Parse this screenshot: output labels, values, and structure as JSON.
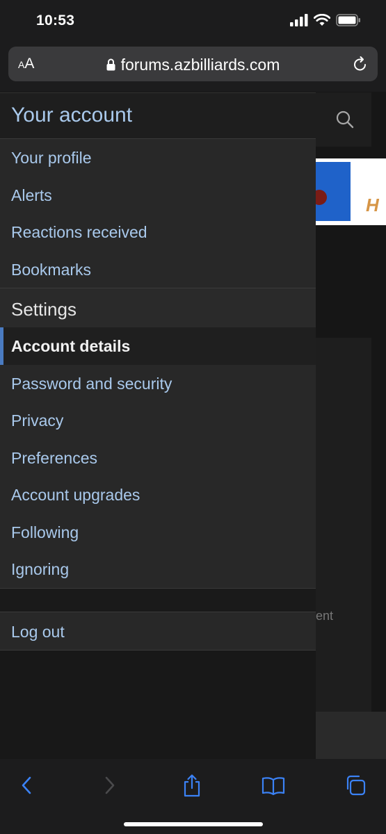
{
  "status": {
    "time": "10:53"
  },
  "browser": {
    "aa_label_small": "A",
    "aa_label_large": "A",
    "url": "forums.azbilliards.com"
  },
  "page": {
    "banner_text": "H",
    "partial_text": "ent"
  },
  "menu": {
    "title": "Your account",
    "account_items": [
      {
        "label": "Your profile"
      },
      {
        "label": "Alerts"
      },
      {
        "label": "Reactions received"
      },
      {
        "label": "Bookmarks"
      }
    ],
    "settings_title": "Settings",
    "settings_items": [
      {
        "label": "Account details",
        "active": true
      },
      {
        "label": "Password and security"
      },
      {
        "label": "Privacy"
      },
      {
        "label": "Preferences"
      },
      {
        "label": "Account upgrades"
      },
      {
        "label": "Following"
      },
      {
        "label": "Ignoring"
      }
    ],
    "logout_label": "Log out"
  },
  "icons": {
    "signal": "signal-icon",
    "wifi": "wifi-icon",
    "battery": "battery-icon",
    "lock": "lock-icon",
    "reload": "reload-icon",
    "search": "search-icon",
    "back": "back-icon",
    "forward": "forward-icon",
    "share": "share-icon",
    "bookmarks": "bookmarks-icon",
    "tabs": "tabs-icon"
  },
  "colors": {
    "link": "#a9c9ec",
    "active_indicator": "#4a7bc1",
    "toolbar_icon": "#3b82f6"
  }
}
